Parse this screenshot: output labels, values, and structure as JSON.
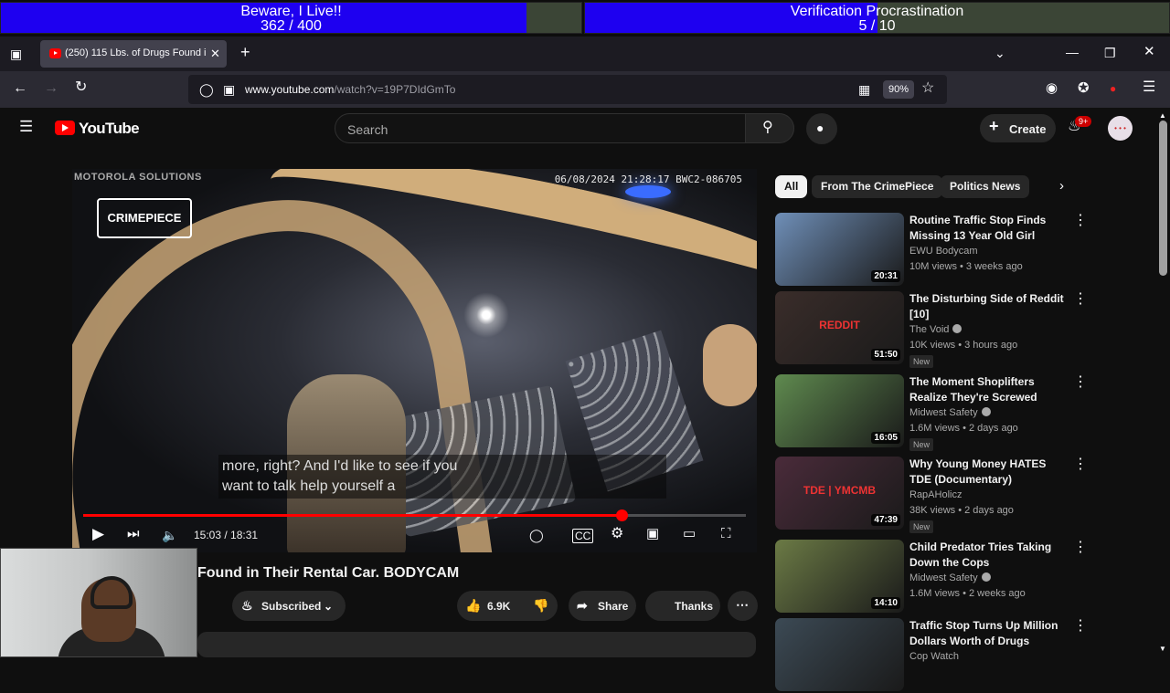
{
  "overlay": {
    "left": {
      "title": "Beware, I Live!!",
      "count": "362 / 400",
      "progress": 0.905
    },
    "right": {
      "title": "Verification Procrastination",
      "count": "5 / 10",
      "progress": 0.5
    }
  },
  "browser": {
    "tab_title": "(250) 115 Lbs. of Drugs Found i",
    "url_domain": "www.youtube.com",
    "url_path": "/watch?v=19P7DIdGmTo",
    "zoom": "90%"
  },
  "youtube": {
    "logo_text": "YouTube",
    "search_placeholder": "Search",
    "create_label": "Create",
    "notif_badge": "9+",
    "avatar_text": "• • •"
  },
  "player": {
    "overlay_brand": "MOTOROLA SOLUTIONS",
    "timestamp": "06/08/2024 21:28:17 BWC2-086705",
    "channel_watermark": "CRIMEPIECE",
    "caption_line1": "more, right? And I'd like to see if you",
    "caption_line2": "want to talk help yourself a",
    "time": "15:03 / 18:31",
    "progress": 0.813
  },
  "video": {
    "title": "Found in Their Rental Car. BODYCAM",
    "subscribed_label": "Subscribed",
    "likes": "6.9K",
    "share_label": "Share",
    "thanks_label": "Thanks"
  },
  "chips": [
    "All",
    "From The CrimePiece",
    "Politics News"
  ],
  "recommendations": [
    {
      "title": "Routine Traffic Stop Finds Missing 13 Year Old Girl",
      "channel": "EWU Bodycam",
      "views": "10M views • 3 weeks ago",
      "duration": "20:31",
      "verified": false,
      "new": "",
      "thumb_color": "#6f8fb8"
    },
    {
      "title": "The Disturbing Side of Reddit [10]",
      "channel": "The Void",
      "views": "10K views • 3 hours ago",
      "duration": "51:50",
      "verified": true,
      "new": "New",
      "thumb_color": "#3a2d2a",
      "thumb_text": "REDDIT"
    },
    {
      "title": "The Moment Shoplifters Realize They're Screwed",
      "channel": "Midwest Safety",
      "views": "1.6M views • 2 days ago",
      "duration": "16:05",
      "verified": true,
      "new": "New",
      "thumb_color": "#5f8a4f"
    },
    {
      "title": "Why Young Money HATES TDE (Documentary)",
      "channel": "RapAHolicz",
      "views": "38K views • 2 days ago",
      "duration": "47:39",
      "verified": false,
      "new": "New",
      "thumb_color": "#4a2b3a",
      "thumb_text": "TDE | YMCMB"
    },
    {
      "title": "Child Predator Tries Taking Down the Cops",
      "channel": "Midwest Safety",
      "views": "1.6M views • 2 weeks ago",
      "duration": "14:10",
      "verified": true,
      "new": "",
      "thumb_color": "#6b7a45"
    },
    {
      "title": "Traffic Stop Turns Up Million Dollars Worth of Drugs",
      "channel": "Cop Watch",
      "views": "",
      "duration": "",
      "verified": false,
      "new": "",
      "thumb_color": "#3c4a55"
    }
  ]
}
